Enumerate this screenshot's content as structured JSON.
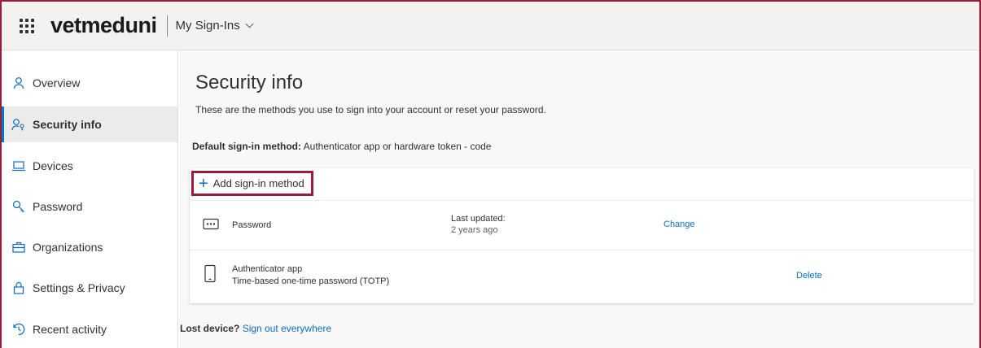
{
  "header": {
    "brand": "vetmeduni",
    "app_name": "My Sign-Ins",
    "waffle_icon": "app-launcher-icon",
    "chevron_icon": "chevron-down-icon"
  },
  "sidebar": {
    "items": [
      {
        "label": "Overview",
        "icon": "person-icon",
        "active": false
      },
      {
        "label": "Security info",
        "icon": "person-key-icon",
        "active": true
      },
      {
        "label": "Devices",
        "icon": "laptop-icon",
        "active": false
      },
      {
        "label": "Password",
        "icon": "key-icon",
        "active": false
      },
      {
        "label": "Organizations",
        "icon": "briefcase-icon",
        "active": false
      },
      {
        "label": "Settings & Privacy",
        "icon": "lock-icon",
        "active": false
      },
      {
        "label": "Recent activity",
        "icon": "history-icon",
        "active": false
      }
    ]
  },
  "main": {
    "title": "Security info",
    "description": "These are the methods you use to sign into your account or reset your password.",
    "default_label": "Default sign-in method:",
    "default_value": " Authenticator app or hardware token - code",
    "add_method_label": "Add sign-in method",
    "methods": [
      {
        "name": "Password",
        "icon": "password-dots-icon",
        "col2_line1": "Last updated:",
        "col2_line2": "2 years ago",
        "action": "Change"
      },
      {
        "name": "Authenticator app",
        "subtitle": "Time-based one-time password (TOTP)",
        "icon": "phone-icon",
        "action": "Delete"
      }
    ],
    "lost_device_label": "Lost device?",
    "sign_out_everywhere": "Sign out everywhere"
  },
  "colors": {
    "accent": "#0f6cbd",
    "highlight_border": "#9b1b3a",
    "header_bg": "#f3f2f1",
    "main_bg": "#f8f8f8"
  }
}
